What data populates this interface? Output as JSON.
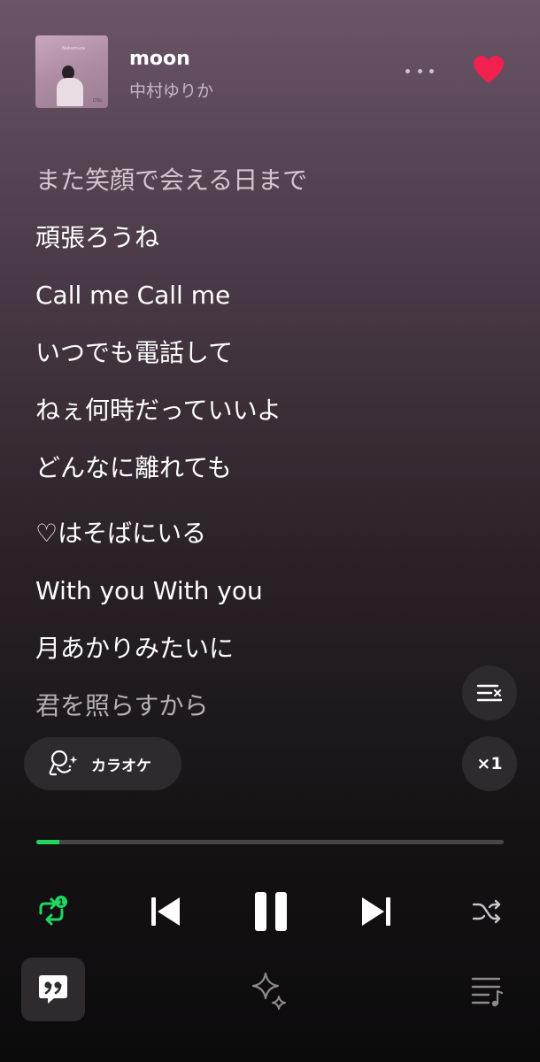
{
  "track": {
    "title": "moon",
    "artist": "中村ゆりか",
    "liked": true,
    "cover_title": "Nakamura",
    "cover_mark": "LTRL"
  },
  "lyrics": [
    "また笑顔で会える日まで",
    "頑張ろうね",
    "Call me Call me",
    "いつでも電話して",
    "ねぇ何時だっていいよ",
    "どんなに離れても",
    "♡はそばにいる",
    "With you With you",
    "月あかりみたいに",
    "君を照らすから"
  ],
  "buttons": {
    "karaoke_label": "カラオケ",
    "speed_label": "×1"
  },
  "playback": {
    "progress_fraction": 0.05,
    "repeat_badge": "1",
    "state": "playing"
  },
  "colors": {
    "accent": "#1ed760",
    "heart": "#f0204f"
  },
  "icons": {
    "more": "more-icon",
    "heart": "heart-icon",
    "queue_clear": "queue-clear-icon",
    "karaoke": "karaoke-mic-icon",
    "repeat": "repeat-one-icon",
    "prev": "skip-previous-icon",
    "pause": "pause-icon",
    "next": "skip-next-icon",
    "shuffle": "shuffle-icon",
    "lyrics": "lyrics-quote-icon",
    "sparkle": "sparkle-icon",
    "playlist": "playlist-icon"
  }
}
